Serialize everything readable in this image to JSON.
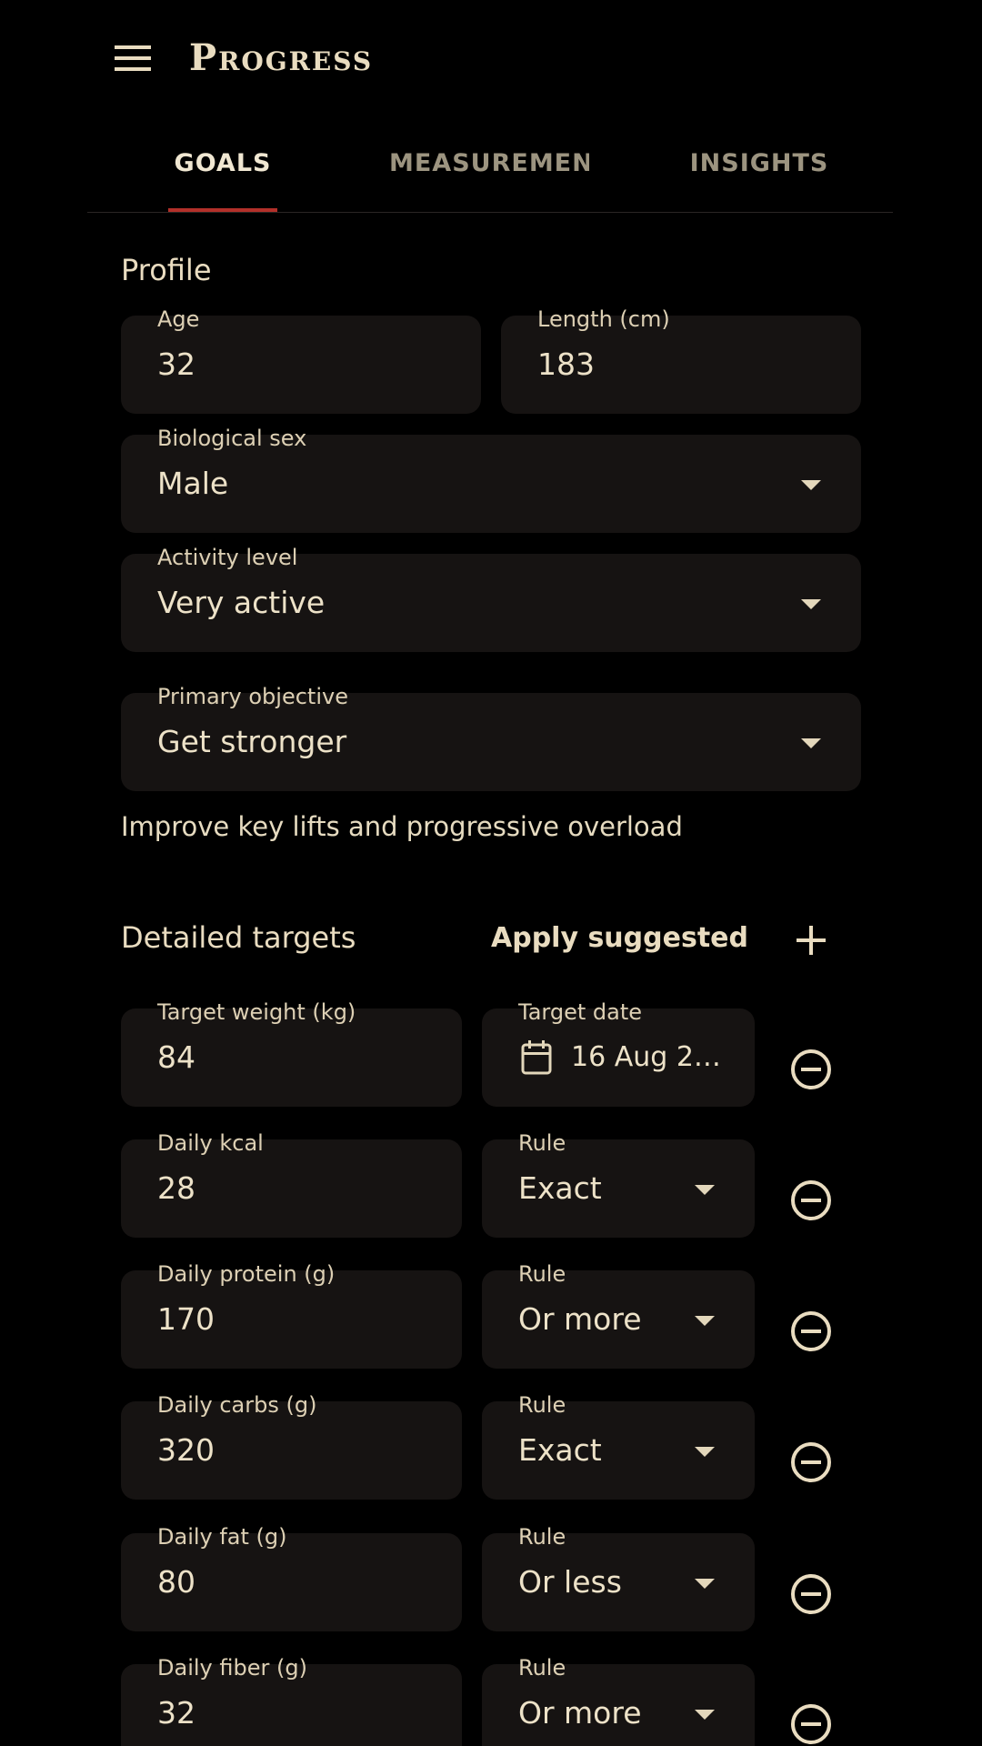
{
  "app_bar": {
    "title": "Progress",
    "menu_icon": "menu-icon"
  },
  "tabs": [
    {
      "label": "GOALS",
      "active": true
    },
    {
      "label": "MEASUREMENTS",
      "active": false
    },
    {
      "label": "INSIGHTS",
      "active": false
    }
  ],
  "profile": {
    "heading": "Profile",
    "age": {
      "label": "Age",
      "value": "32"
    },
    "length": {
      "label": "Length (cm)",
      "value": "183"
    },
    "sex": {
      "label": "Biological sex",
      "value": "Male"
    },
    "activity": {
      "label": "Activity level",
      "value": "Very active"
    },
    "objective": {
      "label": "Primary objective",
      "value": "Get stronger"
    },
    "objective_help": "Improve key lifts and progressive overload"
  },
  "targets": {
    "heading": "Detailed targets",
    "apply_label": "Apply suggested",
    "add_icon": "plus-icon",
    "remove_icon": "minus-circle-icon",
    "weight": {
      "label": "Target weight (kg)",
      "value": "84"
    },
    "date": {
      "label": "Target date",
      "value": "16 Aug 2…",
      "icon": "calendar-icon"
    },
    "rows": [
      {
        "label": "Daily kcal",
        "value": "28",
        "rule_label": "Rule",
        "rule": "Exact"
      },
      {
        "label": "Daily protein (g)",
        "value": "170",
        "rule_label": "Rule",
        "rule": "Or more"
      },
      {
        "label": "Daily carbs (g)",
        "value": "320",
        "rule_label": "Rule",
        "rule": "Exact"
      },
      {
        "label": "Daily fat (g)",
        "value": "80",
        "rule_label": "Rule",
        "rule": "Or less"
      },
      {
        "label": "Daily fiber (g)",
        "value": "32",
        "rule_label": "Rule",
        "rule": "Or more"
      }
    ]
  },
  "colors": {
    "background": "#000000",
    "field_background": "#161312",
    "text": "#e9dcc0",
    "accent_underline": "#b3302a"
  }
}
